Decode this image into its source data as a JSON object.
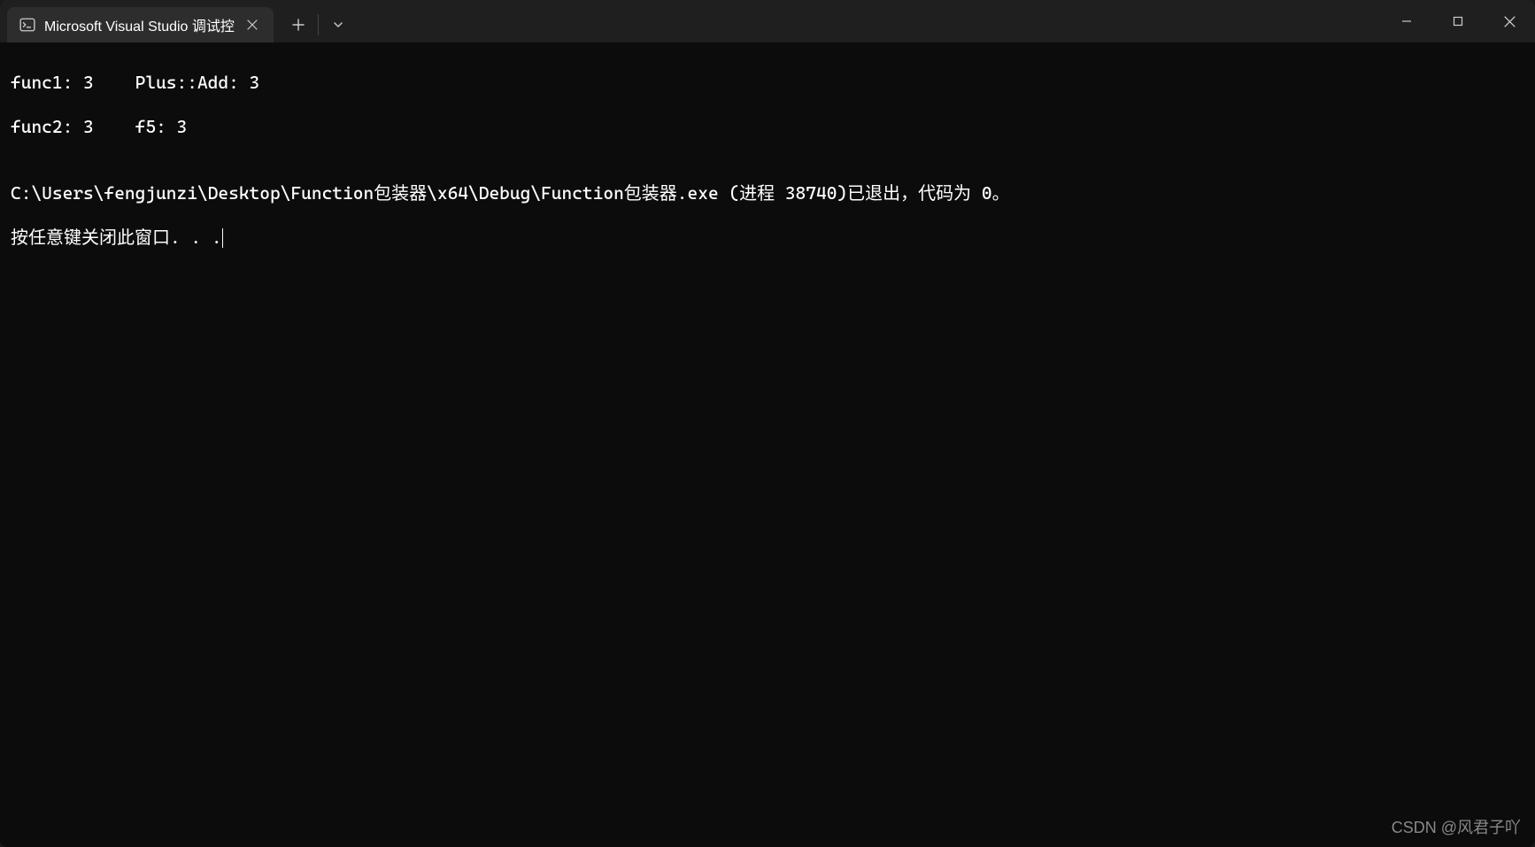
{
  "tab": {
    "title": "Microsoft Visual Studio 调试控"
  },
  "terminal": {
    "line1": "func1: 3    Plus::Add: 3",
    "line2": "func2: 3    f5: 3",
    "line3": "",
    "line4": "C:\\Users\\fengjunzi\\Desktop\\Function包装器\\x64\\Debug\\Function包装器.exe (进程 38740)已退出，代码为 0。",
    "line5": "按任意键关闭此窗口. . ."
  },
  "watermark": "CSDN @风君子吖"
}
